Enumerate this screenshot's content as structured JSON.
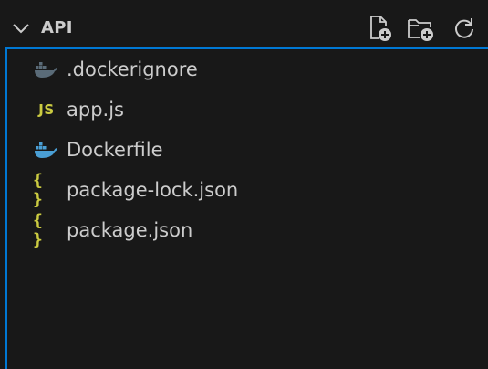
{
  "explorer": {
    "section_title": "API",
    "actions": [
      {
        "name": "new-file",
        "icon": "new-file-icon"
      },
      {
        "name": "new-folder",
        "icon": "new-folder-icon"
      },
      {
        "name": "refresh",
        "icon": "refresh-icon"
      }
    ],
    "files": [
      {
        "name": ".dockerignore",
        "icon": "docker-icon",
        "icon_color": "#5a6b78"
      },
      {
        "name": "app.js",
        "icon": "javascript-icon",
        "icon_text": "JS",
        "icon_color": "#cbcb41"
      },
      {
        "name": "Dockerfile",
        "icon": "docker-icon",
        "icon_color": "#4a9fd5"
      },
      {
        "name": "package-lock.json",
        "icon": "json-icon",
        "icon_text": "{ }",
        "icon_color": "#cbcb41"
      },
      {
        "name": "package.json",
        "icon": "json-icon",
        "icon_text": "{ }",
        "icon_color": "#cbcb41"
      }
    ]
  },
  "colors": {
    "background": "#181818",
    "text": "#cccccc",
    "focus_border": "#0078d4"
  }
}
